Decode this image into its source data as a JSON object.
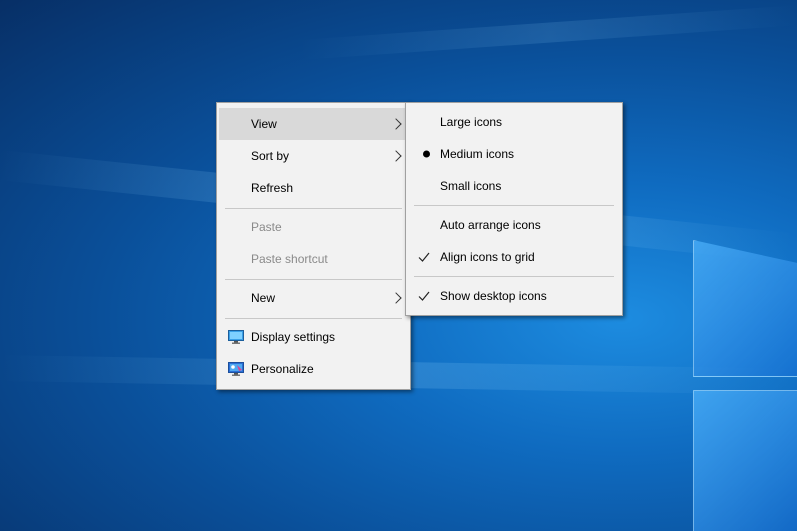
{
  "main_menu": {
    "items": [
      {
        "label": "View",
        "has_submenu": true,
        "highlighted": true,
        "enabled": true
      },
      {
        "label": "Sort by",
        "has_submenu": true,
        "enabled": true
      },
      {
        "label": "Refresh",
        "enabled": true
      },
      {
        "label": "Paste",
        "enabled": false
      },
      {
        "label": "Paste shortcut",
        "enabled": false
      },
      {
        "label": "New",
        "has_submenu": true,
        "enabled": true
      },
      {
        "label": "Display settings",
        "icon": "display-settings-icon",
        "enabled": true
      },
      {
        "label": "Personalize",
        "icon": "personalize-icon",
        "enabled": true
      }
    ]
  },
  "view_submenu": {
    "items": [
      {
        "label": "Large icons",
        "state": "none"
      },
      {
        "label": "Medium icons",
        "state": "selected-radio"
      },
      {
        "label": "Small icons",
        "state": "none"
      },
      {
        "label": "Auto arrange icons",
        "state": "none"
      },
      {
        "label": "Align icons to grid",
        "state": "checked"
      },
      {
        "label": "Show desktop icons",
        "state": "checked"
      }
    ]
  },
  "colors": {
    "menu_background": "#f2f2f2",
    "highlight": "#d9d9d9",
    "disabled_text": "#8a8a8a",
    "desktop_blue": "#0f6bc0"
  }
}
